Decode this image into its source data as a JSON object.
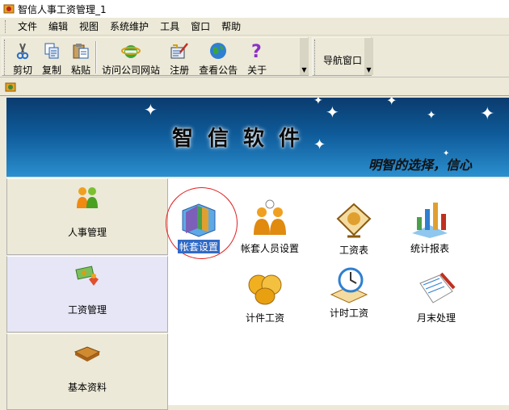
{
  "window": {
    "title": "智信人事工资管理_1"
  },
  "menu": [
    "文件",
    "编辑",
    "视图",
    "系统维护",
    "工具",
    "窗口",
    "帮助"
  ],
  "toolbar": {
    "buttons": [
      {
        "label": "剪切",
        "icon": "scissors-icon"
      },
      {
        "label": "复制",
        "icon": "copy-icon"
      },
      {
        "label": "粘贴",
        "icon": "paste-icon"
      },
      {
        "label": "访问公司网站",
        "icon": "ie-globe-icon"
      },
      {
        "label": "注册",
        "icon": "register-icon"
      },
      {
        "label": "查看公告",
        "icon": "globe-icon"
      },
      {
        "label": "关于",
        "icon": "help-icon"
      }
    ],
    "nav_label": "导航窗口"
  },
  "banner": {
    "brand": "智信软件",
    "slogan": "明智的选择，信心"
  },
  "sidebar": {
    "items": [
      {
        "label": "人事管理",
        "icon": "people-icon",
        "active": false
      },
      {
        "label": "工资管理",
        "icon": "money-icon",
        "active": true
      },
      {
        "label": "基本资料",
        "icon": "book-icon",
        "active": false
      }
    ]
  },
  "functions": [
    {
      "label": "帐套设置",
      "icon": "account-set-icon",
      "selected": true
    },
    {
      "label": "帐套人员设置",
      "icon": "account-people-icon",
      "selected": false
    },
    {
      "label": "工资表",
      "icon": "salary-sheet-icon",
      "selected": false
    },
    {
      "label": "统计报表",
      "icon": "chart-report-icon",
      "selected": false
    },
    {
      "label": "计件工资",
      "icon": "coins-icon",
      "selected": false
    },
    {
      "label": "计时工资",
      "icon": "clock-icon",
      "selected": false
    },
    {
      "label": "月末处理",
      "icon": "notebook-pen-icon",
      "selected": false
    }
  ],
  "colors": {
    "banner_top": "#0b3b6e",
    "banner_bottom": "#2b8fcf",
    "selection": "#316ac5",
    "highlight_circle": "#e02020",
    "active_sidebar": "#e6e6f6"
  }
}
